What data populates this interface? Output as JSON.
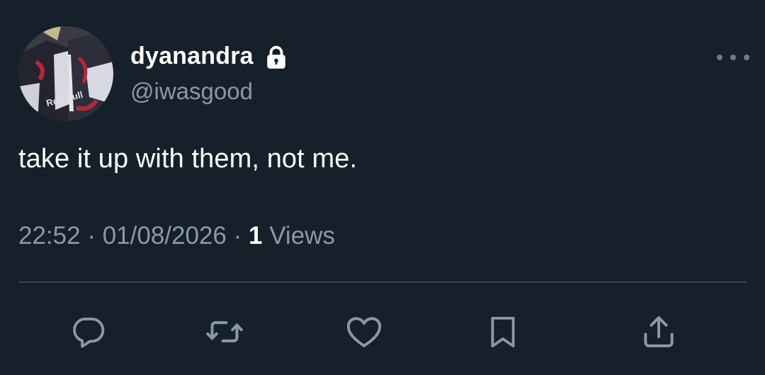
{
  "tweet": {
    "author": {
      "display_name": "dyanandra",
      "handle": "@iwasgood",
      "protected_icon": "lock-icon",
      "avatar_caption": "Red Bull"
    },
    "text": "take it up with them, not me.",
    "time": "22:52",
    "separator": "·",
    "date": "01/08/2026",
    "views_count": "1",
    "views_label": "Views"
  },
  "actions": [
    {
      "name": "reply",
      "icon": "reply-icon"
    },
    {
      "name": "retweet",
      "icon": "retweet-icon"
    },
    {
      "name": "like",
      "icon": "heart-icon"
    },
    {
      "name": "bookmark",
      "icon": "bookmark-icon"
    },
    {
      "name": "share",
      "icon": "share-icon"
    }
  ],
  "colors": {
    "background": "#15202b",
    "primary_text": "#ffffff",
    "secondary_text": "#8b98a5",
    "divider": "#38444d",
    "icon": "#8b98a5"
  }
}
